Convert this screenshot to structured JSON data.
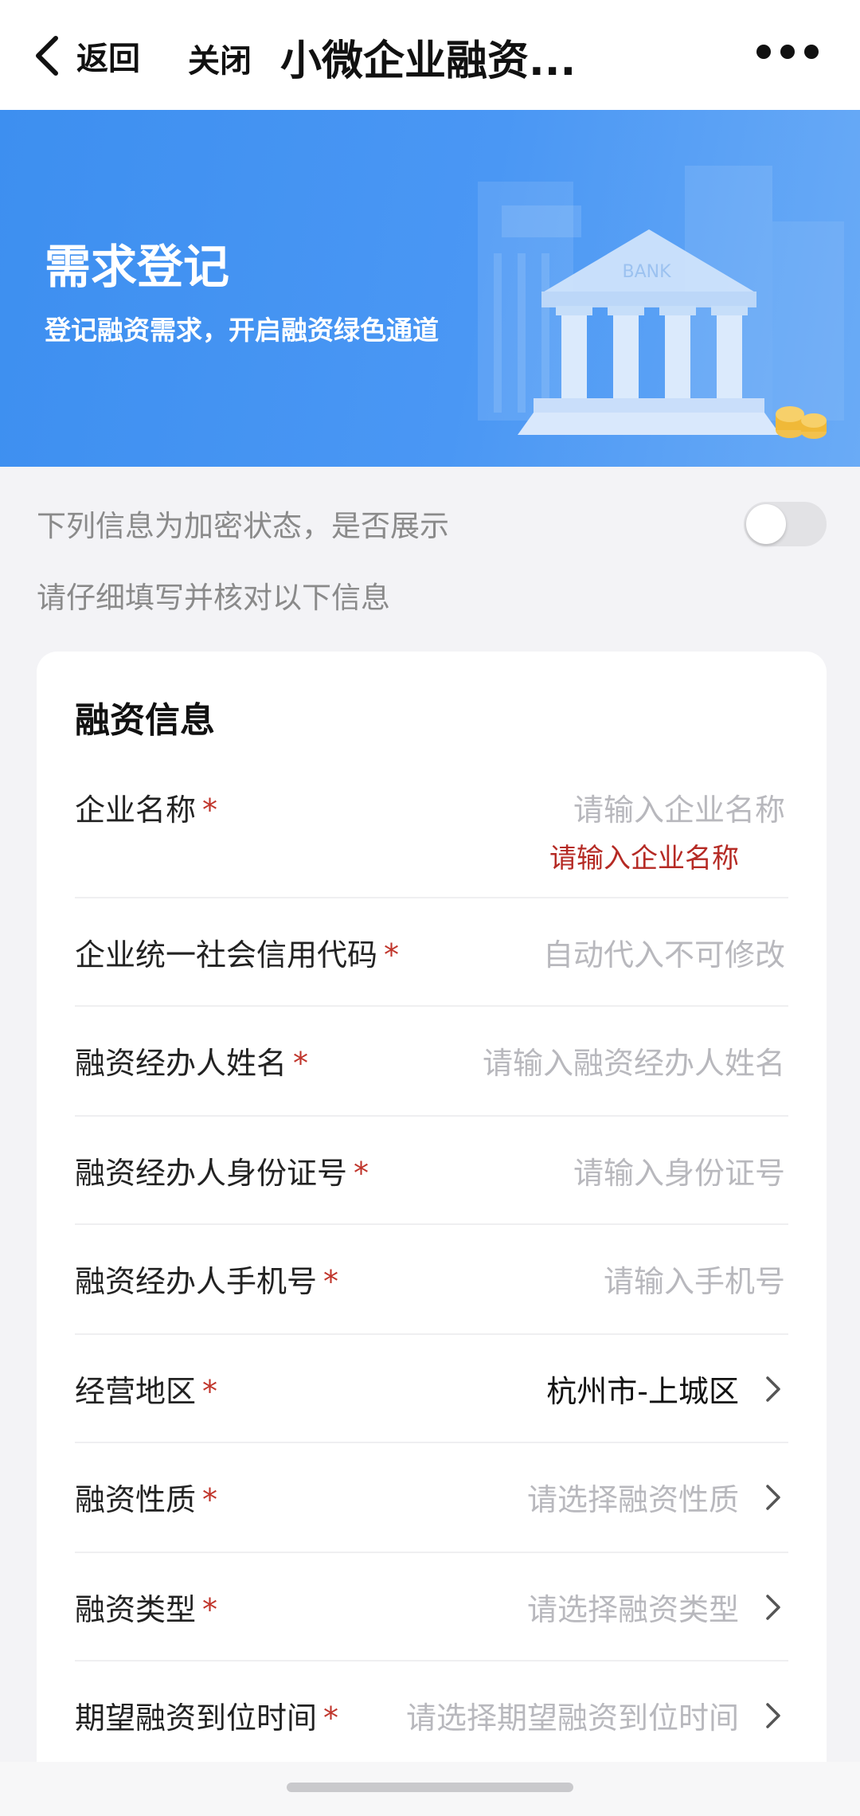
{
  "nav": {
    "back_label": "返回",
    "close_label": "关闭",
    "title": "小微企业融资..."
  },
  "banner": {
    "title": "需求登记",
    "subtitle": "登记融资需求，开启融资绿色通道",
    "illustration_text": "BANK"
  },
  "encryption": {
    "label": "下列信息为加密状态，是否展示",
    "toggle_on": false
  },
  "verify_hint": "请仔细填写并核对以下信息",
  "form": {
    "section_title": "融资信息",
    "required_mark": "*",
    "fields": [
      {
        "label": "企业名称",
        "placeholder": "请输入企业名称",
        "value": "",
        "error": "请输入企业名称",
        "chevron": false
      },
      {
        "label": "企业统一社会信用代码",
        "placeholder": "自动代入不可修改",
        "value": "",
        "chevron": false
      },
      {
        "label": "融资经办人姓名",
        "placeholder": "请输入融资经办人姓名",
        "value": "",
        "chevron": false
      },
      {
        "label": "融资经办人身份证号",
        "placeholder": "请输入身份证号",
        "value": "",
        "chevron": false
      },
      {
        "label": "融资经办人手机号",
        "placeholder": "请输入手机号",
        "value": "",
        "chevron": false
      },
      {
        "label": "经营地区",
        "placeholder": "",
        "value": "杭州市-上城区",
        "chevron": true
      },
      {
        "label": "融资性质",
        "placeholder": "请选择融资性质",
        "value": "",
        "chevron": true
      },
      {
        "label": "融资类型",
        "placeholder": "请选择融资类型",
        "value": "",
        "chevron": true
      },
      {
        "label": "期望融资到位时间",
        "placeholder": "请选择期望融资到位时间",
        "value": "",
        "chevron": true
      }
    ]
  },
  "colors": {
    "banner_blue": "#4a97f4",
    "required_red": "#c0352b",
    "placeholder_gray": "#b8b8bd",
    "page_bg": "#f3f3f6"
  }
}
